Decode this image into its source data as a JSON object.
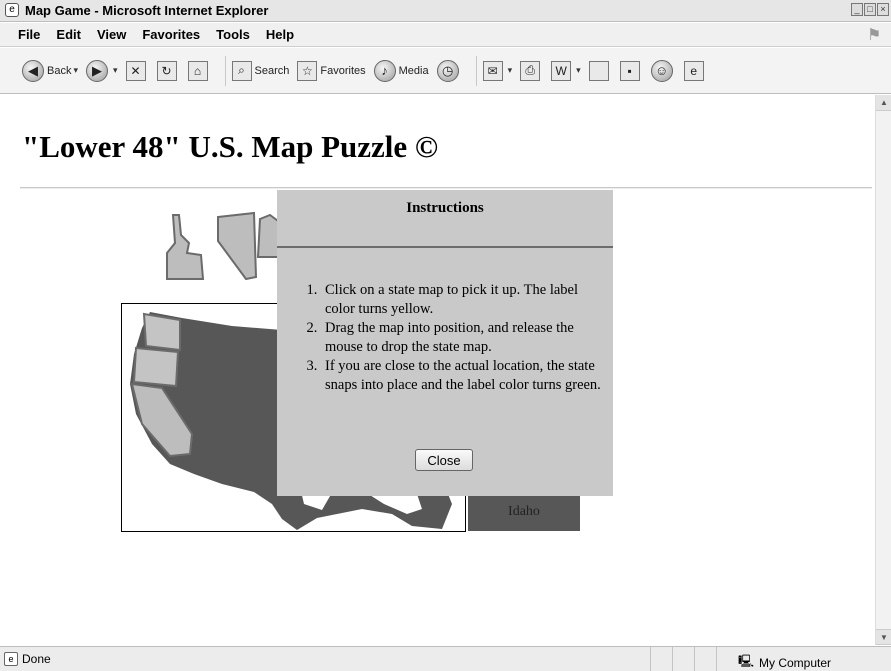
{
  "window": {
    "title": "Map Game - Microsoft Internet Explorer"
  },
  "menu": [
    "File",
    "Edit",
    "View",
    "Favorites",
    "Tools",
    "Help"
  ],
  "toolbar": {
    "back": "Back",
    "search": "Search",
    "favorites": "Favorites",
    "media": "Media"
  },
  "page": {
    "title": "\"Lower 48\" U.S. Map Puzzle",
    "title_icon": "©"
  },
  "label_box": "Idaho",
  "dialog": {
    "title": "Instructions",
    "steps": [
      "Click on a state map to pick it up. The label color turns yellow.",
      "Drag the map into position, and release the mouse to drop the state map.",
      "If you are close to the actual location, the state snaps into place and the label color turns green."
    ],
    "close_label": "Close"
  },
  "status": {
    "text": "Done",
    "zone": "My Computer"
  },
  "colors": {
    "map_fill": "#575757",
    "dialog_bg": "#c9c9c9"
  }
}
